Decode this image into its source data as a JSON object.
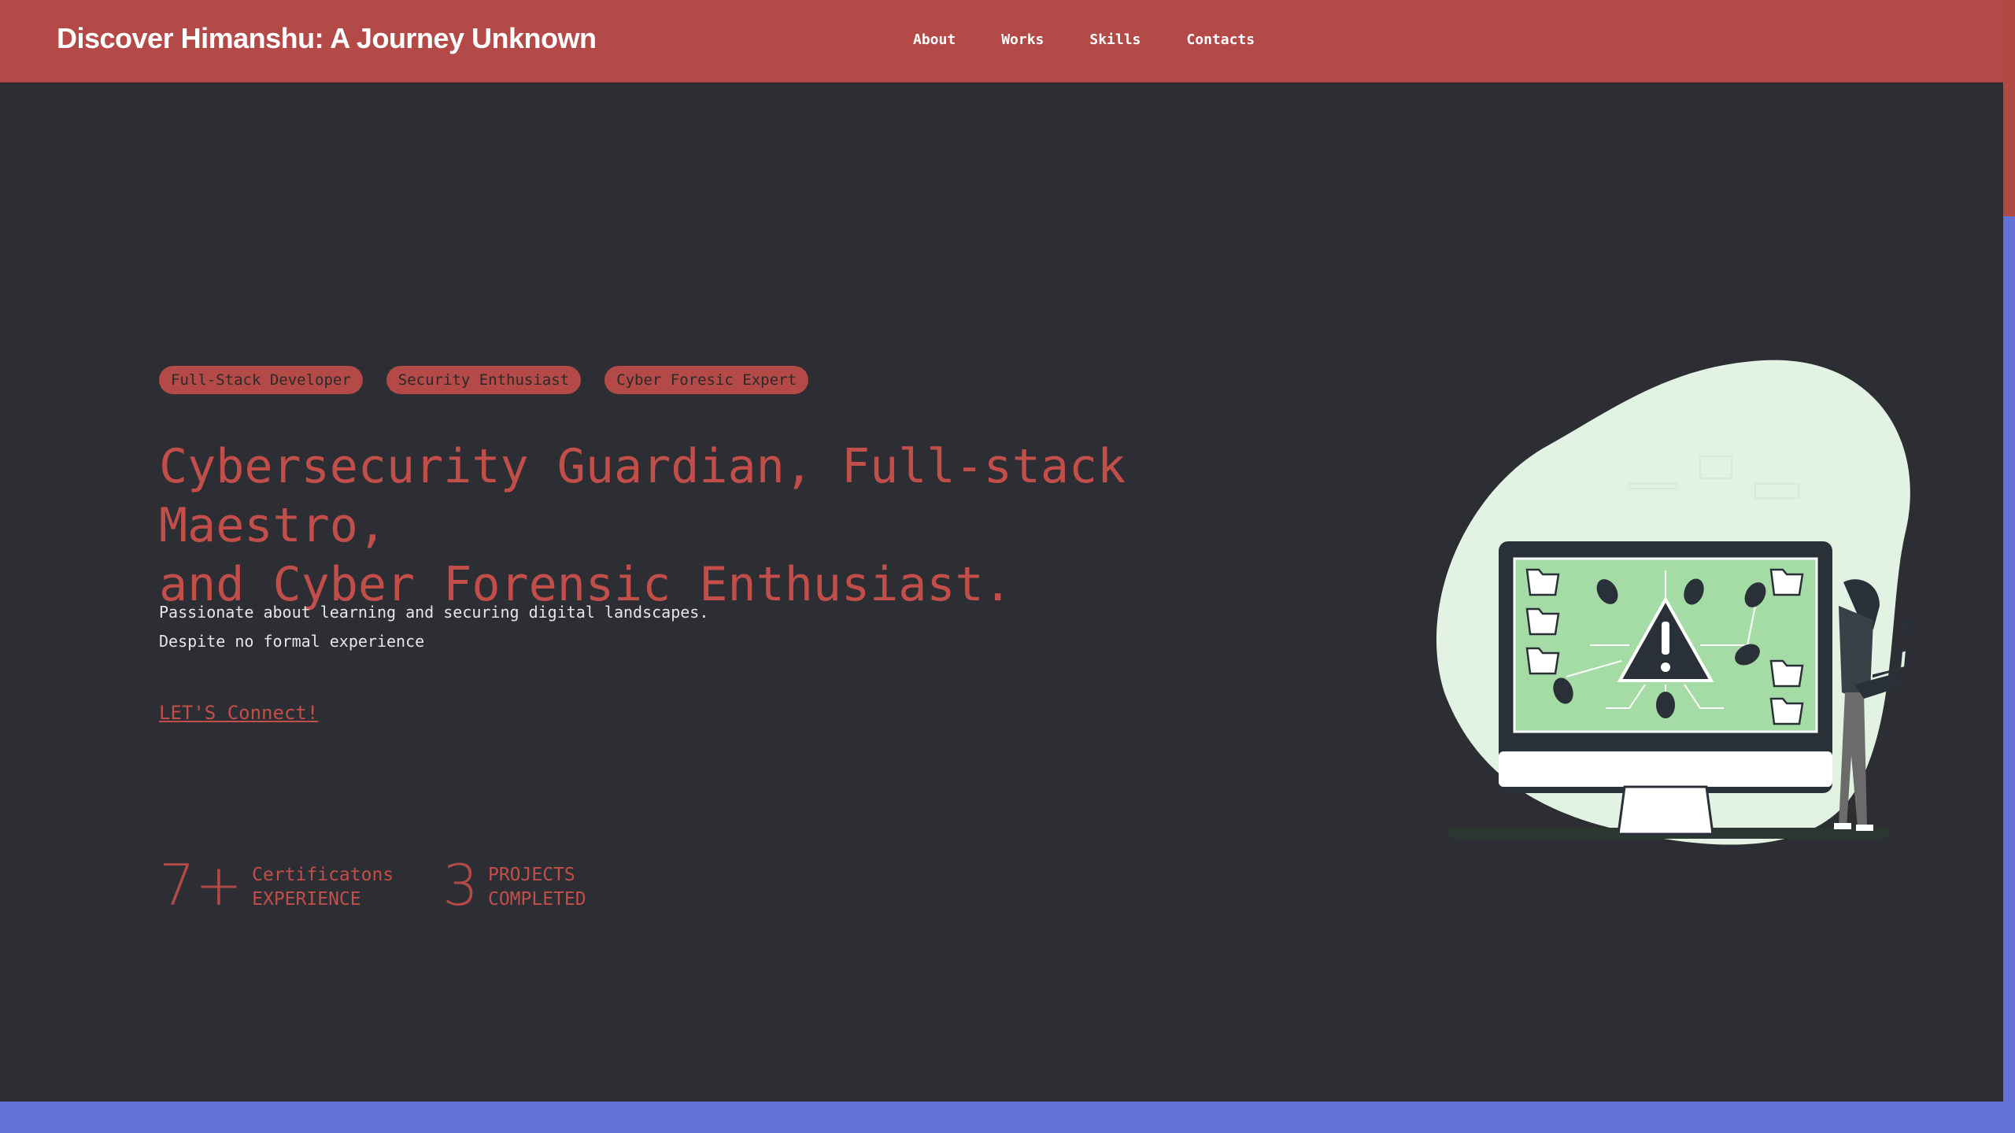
{
  "brand": "Discover Himanshu: A Journey Unknown",
  "nav": [
    "About",
    "Works",
    "Skills",
    "Contacts"
  ],
  "tags": [
    "Full-Stack Developer",
    "Security Enthusiast",
    "Cyber Foresic Expert"
  ],
  "headline": {
    "line1": "Cybersecurity Guardian, Full-stack Maestro,",
    "line2": "and Cyber Forensic Enthusiast."
  },
  "description": {
    "line1": "Passionate about learning and securing digital landscapes.",
    "line2": "Despite no formal experience"
  },
  "cta": "LET'S Connect!",
  "stats": [
    {
      "number": "7+",
      "label1": "Certificatons",
      "label2": "EXPERIENCE"
    },
    {
      "number": "3",
      "label1": "PROJECTS",
      "label2": "COMPLETED"
    }
  ],
  "colors": {
    "accent": "#b34a47",
    "headline": "#c24e4a",
    "background": "#2c2e33",
    "bottom_band": "#6272d6",
    "illustration_blob": "#e3f3e3",
    "screen_green": "#a5dca5"
  },
  "illustration": "hacker-with-laptop-and-infected-monitor-illustration"
}
